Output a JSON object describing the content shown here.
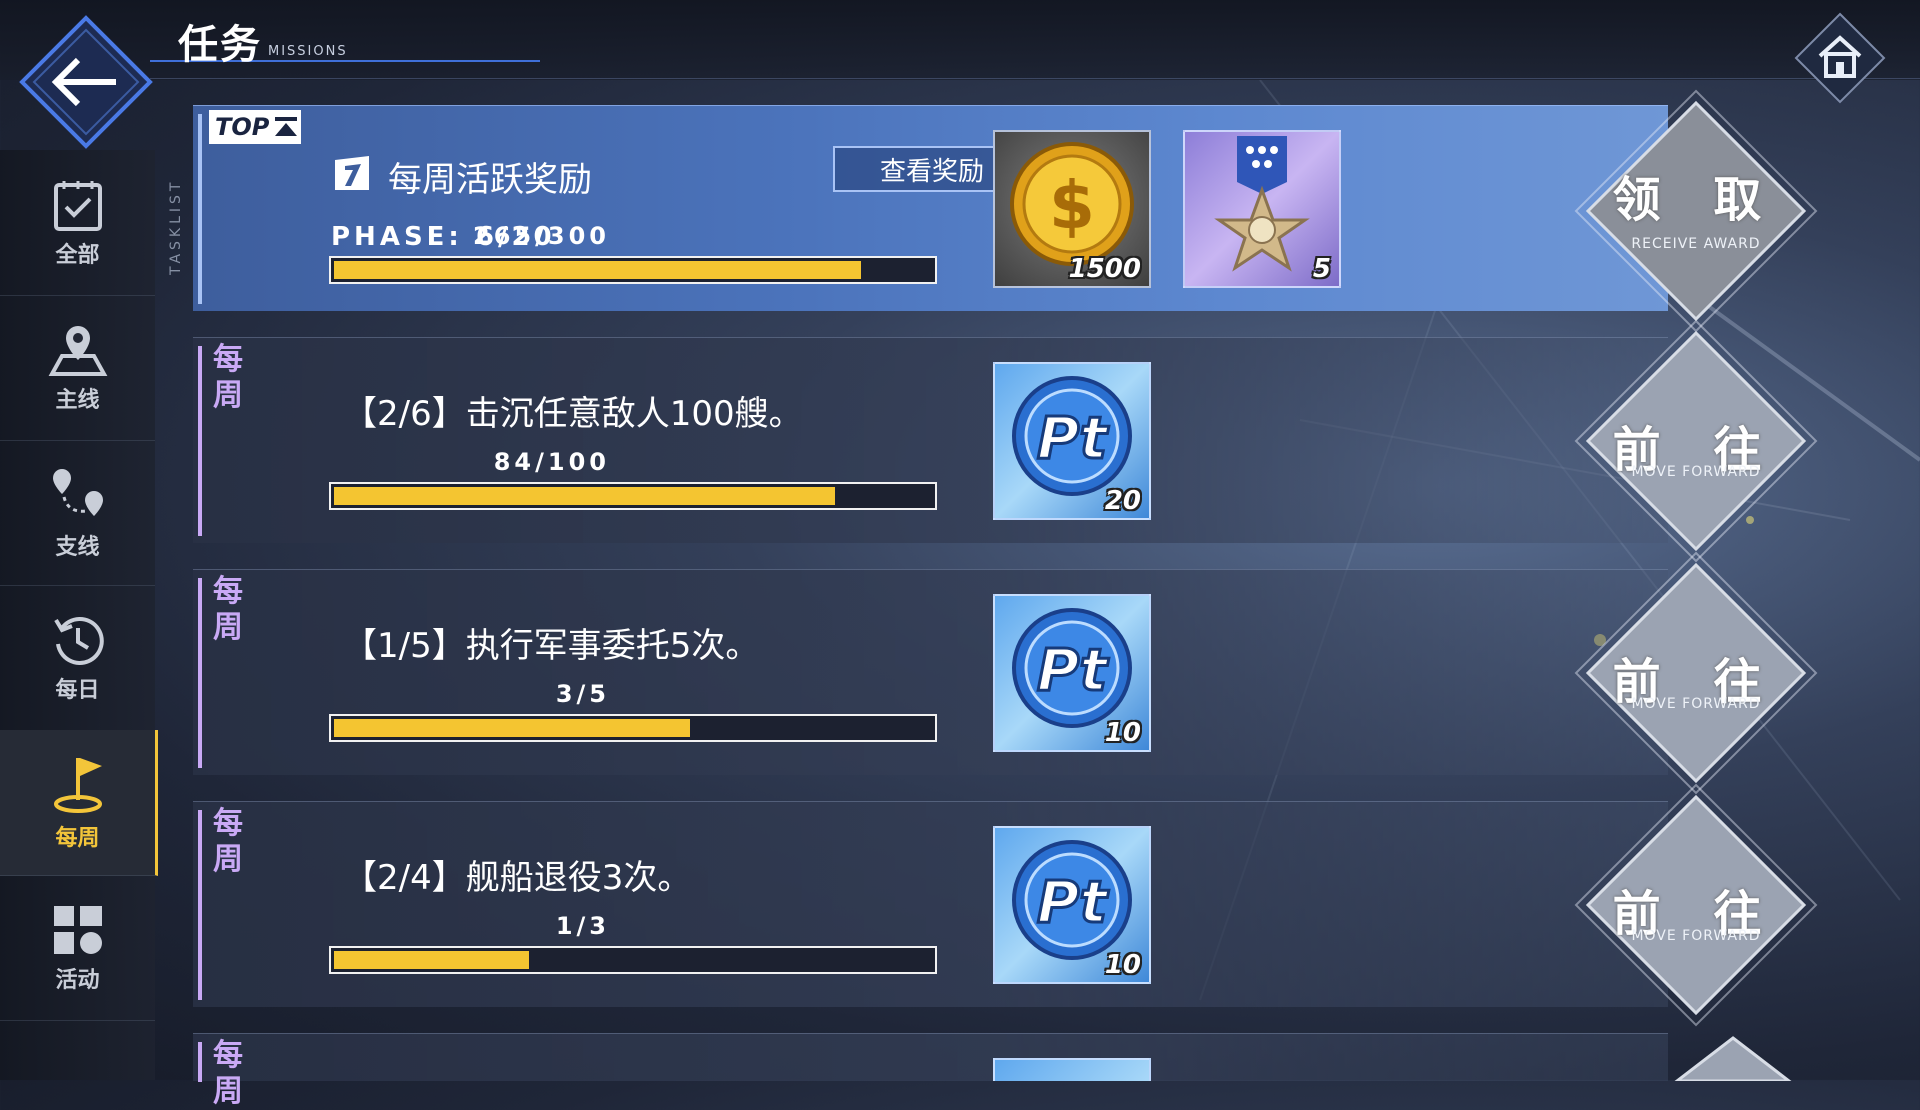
{
  "header": {
    "title": "任务",
    "subtitle": "MISSIONS"
  },
  "sidebar": {
    "tasklist_label": "TASKLIST",
    "items": [
      {
        "label": "全部",
        "icon": "checklist-icon"
      },
      {
        "label": "主线",
        "icon": "map-pin-icon"
      },
      {
        "label": "支线",
        "icon": "route-pins-icon"
      },
      {
        "label": "每日",
        "icon": "clock-history-icon"
      },
      {
        "label": "每周",
        "icon": "flag-icon",
        "active": true
      },
      {
        "label": "活动",
        "icon": "grid-icon"
      }
    ]
  },
  "top_row": {
    "badge": "TOP",
    "title": "每周活跃奖励",
    "view_button": "查看奖励",
    "phase": "PHASE: 6/20",
    "progress_text": "265/300",
    "progress": 0.883,
    "rewards": [
      {
        "name": "gold-coin-icon",
        "qty": "1500"
      },
      {
        "name": "medal-icon",
        "qty": "5"
      }
    ],
    "button_label": "领 取",
    "button_sub": "RECEIVE AWARD"
  },
  "missions": [
    {
      "tag": "每周",
      "text": "【2/6】击沉任意敌人100艘。",
      "progress_text": "84/100",
      "progress": 0.84,
      "reward_qty": "20",
      "button_label": "前 往",
      "button_sub": "MOVE FORWARD"
    },
    {
      "tag": "每周",
      "text": "【1/5】执行军事委托5次。",
      "progress_text": "3/5",
      "progress": 0.6,
      "reward_qty": "10",
      "button_label": "前 往",
      "button_sub": "MOVE FORWARD"
    },
    {
      "tag": "每周",
      "text": "【2/4】舰船退役3次。",
      "progress_text": "1/3",
      "progress": 0.333,
      "reward_qty": "10",
      "button_label": "前 往",
      "button_sub": "MOVE FORWARD"
    }
  ],
  "partial_row": {
    "tag": "每周"
  },
  "colors": {
    "accent_yellow": "#f4c531",
    "weekly_purple": "#c9a9f5",
    "top_blue": "#4b73bb"
  }
}
